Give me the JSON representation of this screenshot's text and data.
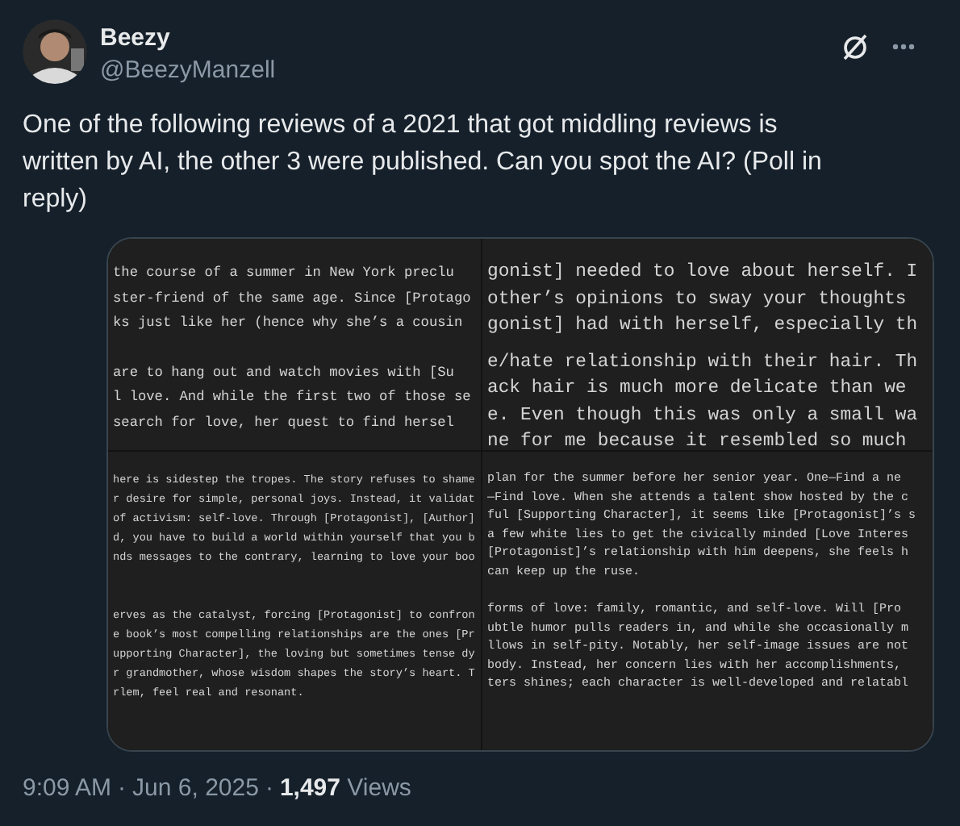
{
  "author": {
    "name": "Beezy",
    "handle": "@BeezyManzell"
  },
  "text": "One of the following reviews of a 2021 that got middling reviews is written by AI, the other 3 were published. Can you spot the AI? (Poll in reply)",
  "media": {
    "panels": [
      {
        "paragraphs": [
          [
            "the course of a summer in New York preclu",
            "ster-friend of the same age. Since [Protago",
            "ks just like her (hence why she’s a cousin"
          ],
          [
            "are to hang out and watch movies with [Su",
            "l love. And while the first two of those se",
            "search for love, her quest to find hersel"
          ]
        ]
      },
      {
        "paragraphs": [
          [
            "gonist] needed to love about herself. I",
            "other’s opinions to sway your thoughts",
            "gonist] had with herself, especially th"
          ],
          [
            "e/hate relationship with their hair. Th",
            "ack hair is much more delicate than we",
            "e. Even though this was only a small wa",
            "ne for me because it resembled so much"
          ]
        ]
      },
      {
        "paragraphs": [
          [
            "here is sidestep the tropes. The story refuses to shame",
            "r desire for simple, personal joys. Instead, it validat",
            "of activism: self-love. Through [Protagonist], [Author]",
            "d, you have to build a world within yourself that you b",
            "nds messages to the contrary, learning to love your boo"
          ],
          [
            "erves as the catalyst, forcing [Protagonist] to confron",
            "e book’s most compelling relationships are the ones [Pr",
            "upporting Character], the loving but sometimes tense dy",
            "r grandmother, whose wisdom shapes the story’s heart. T",
            "rlem, feel real and resonant."
          ]
        ]
      },
      {
        "paragraphs": [
          [
            "plan for the summer before her senior year. One—Find a ne",
            "—Find love. When she attends a talent show hosted by the c",
            "ful [Supporting Character], it seems like [Protagonist]’s s",
            "a few white lies to get the civically minded [Love Interes",
            "[Protagonist]’s relationship with him deepens, she feels h",
            "can keep up the ruse."
          ],
          [
            "forms of love: family, romantic, and self-love. Will [Pro",
            "ubtle humor pulls readers in, and while she occasionally m",
            "llows in self-pity. Notably, her self-image issues are not",
            "body. Instead, her concern lies with her accomplishments,",
            "ters shines; each character is well-developed and relatabl"
          ]
        ]
      }
    ]
  },
  "footer": {
    "time": "9:09 AM",
    "separator_1": "·",
    "date": "Jun 6, 2025",
    "separator_2": "·",
    "views_count": "1,497",
    "views_label": "Views"
  }
}
